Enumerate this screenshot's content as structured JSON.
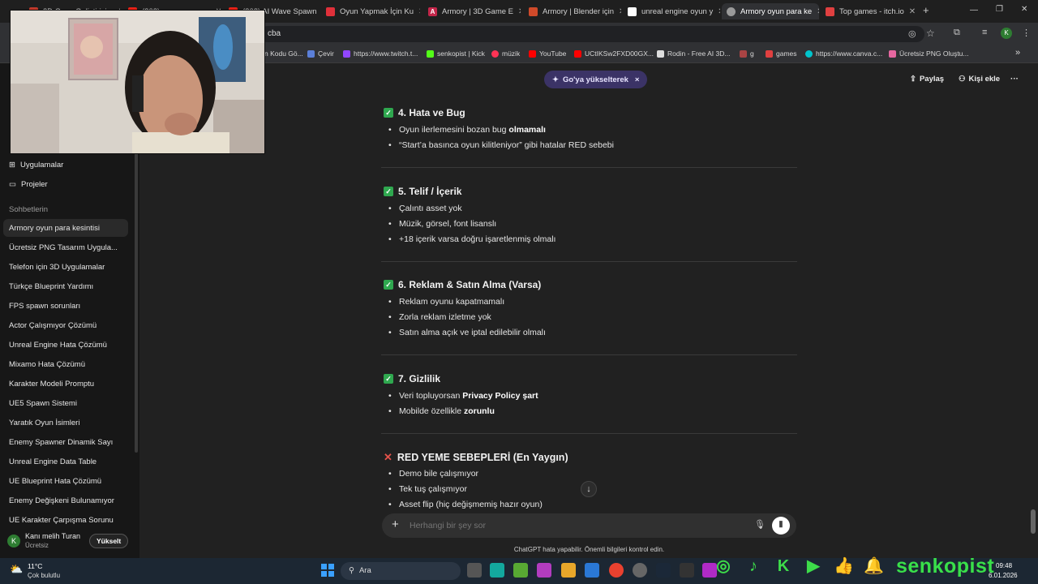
{
  "browser": {
    "tabs": [
      {
        "label": "3D Oyun Geliştirici...",
        "active": false
      },
      {
        "label": "(202) oyun yapma...",
        "active": false
      },
      {
        "label": "(202) AI Wave Spawn",
        "active": false
      },
      {
        "label": "Oyun Yapmak İçin Ku",
        "active": false
      },
      {
        "label": "Armory | 3D Game E",
        "active": false
      },
      {
        "label": "Armory | Blender için",
        "active": false
      },
      {
        "label": "unreal engine oyun y",
        "active": false
      },
      {
        "label": "Armory oyun para ke",
        "active": true
      },
      {
        "label": "Top games - itch.io",
        "active": false
      }
    ],
    "new_tab": "+",
    "address_text": "cba",
    "bookmarks": [
      "n Kodu Gö...",
      "Çevir",
      "https://www.twitch.t...",
      "senkopist | Kick",
      "müzik",
      "YouTube",
      "UCtIKSw2FXD00GX...",
      "Rodin - Free AI 3D...",
      "g",
      "games",
      "https://www.canva.c...",
      "Ücretsiz PNG Oluştu..."
    ],
    "bookmarks_more": "»"
  },
  "sidebar": {
    "nav": [
      {
        "label": "Uygulamalar",
        "icon": "apps-icon"
      },
      {
        "label": "Projeler",
        "icon": "folder-icon"
      }
    ],
    "section_label": "Sohbetlerin",
    "chats": [
      "Armory oyun para kesintisi",
      "Ücretsiz PNG Tasarım Uygula...",
      "Telefon için 3D Uygulamalar",
      "Türkçe Blueprint Yardımı",
      "FPS spawn sorunları",
      "Actor Çalışmıyor Çözümü",
      "Unreal Engine Hata Çözümü",
      "Mixamo Hata Çözümü",
      "Karakter Modeli Promptu",
      "UE5 Spawn Sistemi",
      "Yaratık Oyun İsimleri",
      "Enemy Spawner Dinamik Sayı",
      "Unreal Engine Data Table",
      "UE Blueprint Hata Çözümü",
      "Enemy Değişkeni Bulunamıyor",
      "UE Karakter Çarpışma Sorunu"
    ],
    "user": {
      "avatar": "K",
      "name": "Kanı melih Turan",
      "plan": "Ücretsiz",
      "upgrade": "Yükselt"
    }
  },
  "header": {
    "upgrade_pill": "Go'ya yükselterek",
    "upgrade_close": "×",
    "share": "Paylaş",
    "add_person": "Kişi ekle",
    "more": "···"
  },
  "content": {
    "sections": [
      {
        "marker": "check",
        "title": "4. Hata ve Bug",
        "bullets": [
          {
            "text": "Oyun ilerlemesini bozan bug ",
            "bold": "olmamalı"
          },
          {
            "text": "“Start’a basınca oyun kilitleniyor” gibi hatalar RED sebebi",
            "bold": ""
          }
        ]
      },
      {
        "marker": "check",
        "title": "5. Telif / İçerik",
        "bullets": [
          {
            "text": "Çalıntı asset yok",
            "bold": ""
          },
          {
            "text": "Müzik, görsel, font lisanslı",
            "bold": ""
          },
          {
            "text": "+18 içerik varsa doğru işaretlenmiş olmalı",
            "bold": ""
          }
        ]
      },
      {
        "marker": "check",
        "title": "6. Reklam & Satın Alma (Varsa)",
        "bullets": [
          {
            "text": "Reklam oyunu kapatmamalı",
            "bold": ""
          },
          {
            "text": "Zorla reklam izletme yok",
            "bold": ""
          },
          {
            "text": "Satın alma açık ve iptal edilebilir olmalı",
            "bold": ""
          }
        ]
      },
      {
        "marker": "check",
        "title": "7. Gizlilik",
        "bullets": [
          {
            "text": "Veri topluyorsan ",
            "bold": "Privacy Policy şart"
          },
          {
            "text": "Mobilde özellikle ",
            "bold": "zorunlu"
          }
        ]
      },
      {
        "marker": "cross",
        "title": "RED YEME SEBEPLERİ (En Yaygın)",
        "bullets": [
          {
            "text": "Demo bile çalışmıyor",
            "bold": ""
          },
          {
            "text": "Tek tuş çalışmıyor",
            "bold": ""
          },
          {
            "text": "Asset flip (hiç değişmemiş hazır oyun)",
            "bold": ""
          }
        ]
      }
    ]
  },
  "composer": {
    "placeholder": "Herhangi bir şey sor",
    "disclaimer": "ChatGPT hata yapabilir. Önemli bilgileri kontrol edin."
  },
  "taskbar": {
    "weather_temp": "11°C",
    "weather_desc": "Çok bulutlu",
    "search": "Ara",
    "time": "09:48",
    "date": "6.01.2026"
  },
  "overlay": {
    "channel": "senkopist"
  },
  "colors": {
    "bg": "#212121",
    "sidebar": "#171717",
    "check": "#2fa84f",
    "cross": "#e5534b",
    "social": "#39e04a",
    "upgrade_pill": "#3b3366"
  }
}
